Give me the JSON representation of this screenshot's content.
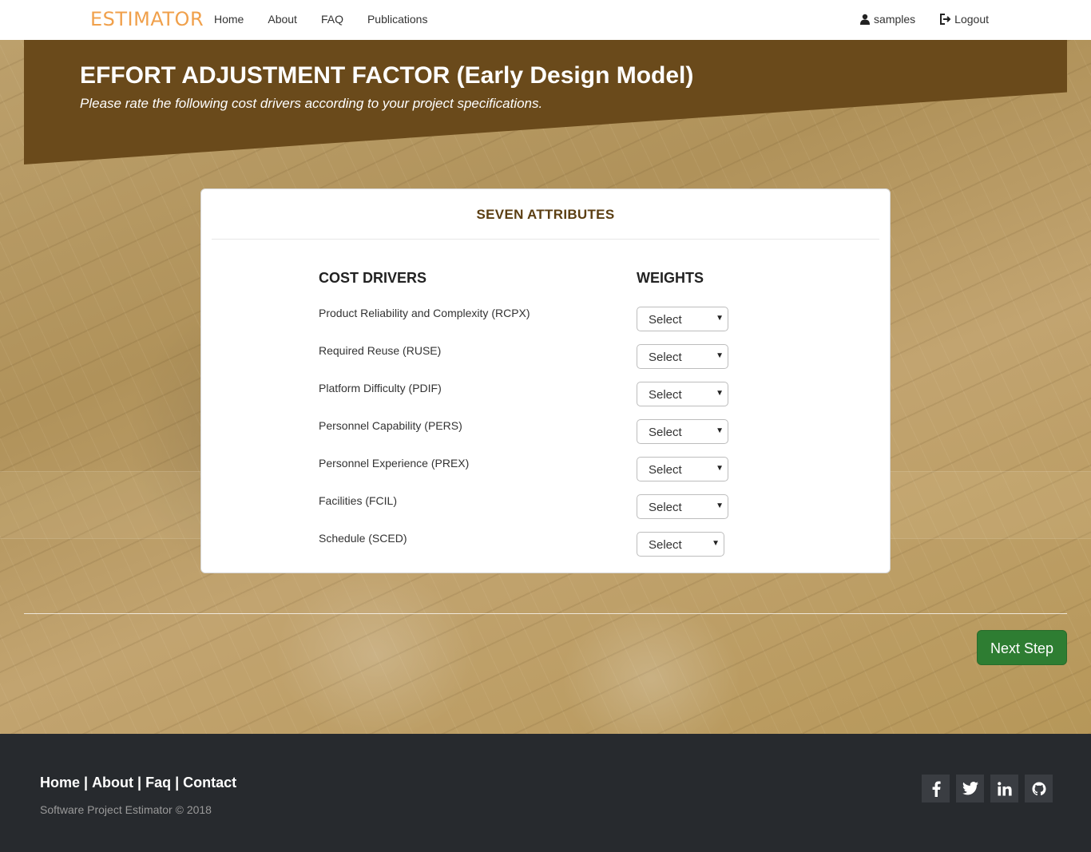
{
  "navbar": {
    "brand": "ESTIMATOR",
    "links": [
      {
        "label": "Home"
      },
      {
        "label": "About"
      },
      {
        "label": "FAQ"
      },
      {
        "label": "Publications"
      }
    ],
    "user_label": "samples",
    "user_icon": "user-icon",
    "logout_label": "Logout",
    "logout_icon": "logout-icon"
  },
  "banner": {
    "title": "EFFORT ADJUSTMENT FACTOR (Early Design Model)",
    "subtitle": "Please rate the following cost drivers according to your project specifications."
  },
  "card": {
    "title": "SEVEN ATTRIBUTES",
    "col_drivers": "COST DRIVERS",
    "col_weights": "WEIGHTS",
    "rows": [
      {
        "label": "Product Reliability and Complexity (RCPX)",
        "selected": "Select"
      },
      {
        "label": "Required Reuse (RUSE)",
        "selected": "Select"
      },
      {
        "label": "Platform Difficulty (PDIF)",
        "selected": "Select"
      },
      {
        "label": "Personnel Capability (PERS)",
        "selected": "Select"
      },
      {
        "label": "Personnel Experience (PREX)",
        "selected": "Select"
      },
      {
        "label": "Facilities (FCIL)",
        "selected": "Select"
      },
      {
        "label": "Schedule (SCED)",
        "selected": "Select"
      }
    ]
  },
  "next_button": "Next Step",
  "footer": {
    "links": [
      "Home",
      "About",
      "Faq",
      "Contact"
    ],
    "separator": "|",
    "copyright": "Software Project Estimator © 2018",
    "socials": [
      "facebook-icon",
      "twitter-icon",
      "linkedin-icon",
      "github-icon"
    ]
  },
  "colors": {
    "brand": "#f0a04b",
    "banner": "#6a4a1b",
    "card_title": "#5b3e12",
    "next_button": "#2e7d32",
    "footer": "#272a2e"
  }
}
